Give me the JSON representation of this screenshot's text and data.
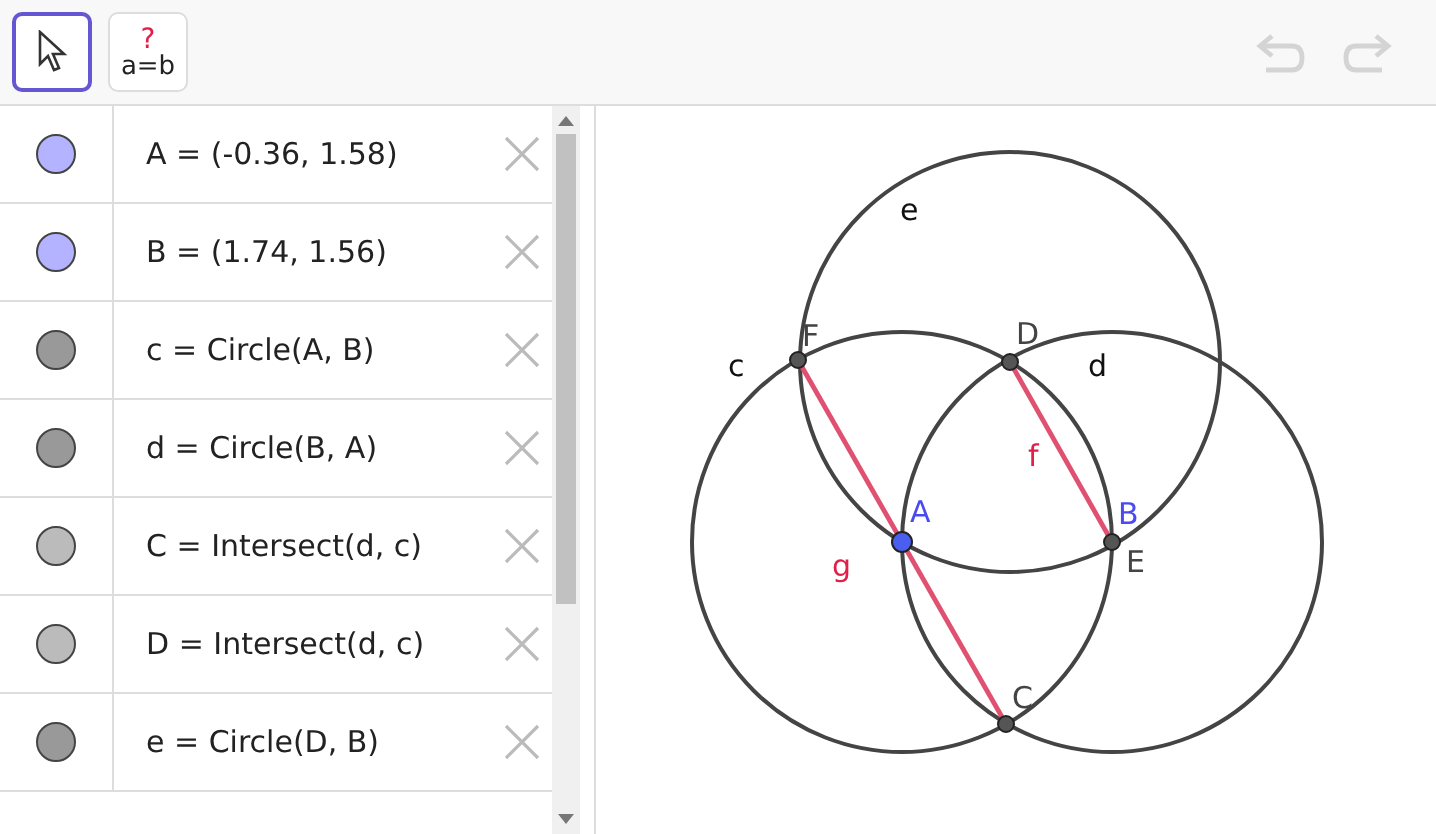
{
  "toolbar": {
    "tools": [
      {
        "kind": "move",
        "selected": true
      },
      {
        "kind": "relation",
        "selected": false,
        "mark": "?",
        "label": "a=b"
      }
    ],
    "undo": {
      "disabled": true
    },
    "redo": {
      "disabled": true
    }
  },
  "algebra": {
    "rows": [
      {
        "text": "A = (-0.36, 1.58)",
        "color": "#b3b3ff"
      },
      {
        "text": "B = (1.74, 1.56)",
        "color": "#b3b3ff"
      },
      {
        "text": "c = Circle(A, B)",
        "color": "#999999"
      },
      {
        "text": "d = Circle(B, A)",
        "color": "#999999"
      },
      {
        "text": "C = Intersect(d, c)",
        "color": "#bbbbbb"
      },
      {
        "text": "D = Intersect(d, c)",
        "color": "#bbbbbb"
      },
      {
        "text": "e = Circle(D, B)",
        "color": "#999999"
      }
    ]
  },
  "canvas": {
    "labels": [
      {
        "text": "e",
        "kind": "object"
      },
      {
        "text": "c",
        "kind": "object"
      },
      {
        "text": "d",
        "kind": "object"
      },
      {
        "text": "F",
        "kind": "point"
      },
      {
        "text": "D",
        "kind": "point"
      },
      {
        "text": "A",
        "kind": "free-point"
      },
      {
        "text": "B",
        "kind": "free-point"
      },
      {
        "text": "E",
        "kind": "point"
      },
      {
        "text": "f",
        "kind": "segment"
      },
      {
        "text": "g",
        "kind": "segment"
      },
      {
        "text": "C",
        "kind": "point"
      }
    ]
  }
}
